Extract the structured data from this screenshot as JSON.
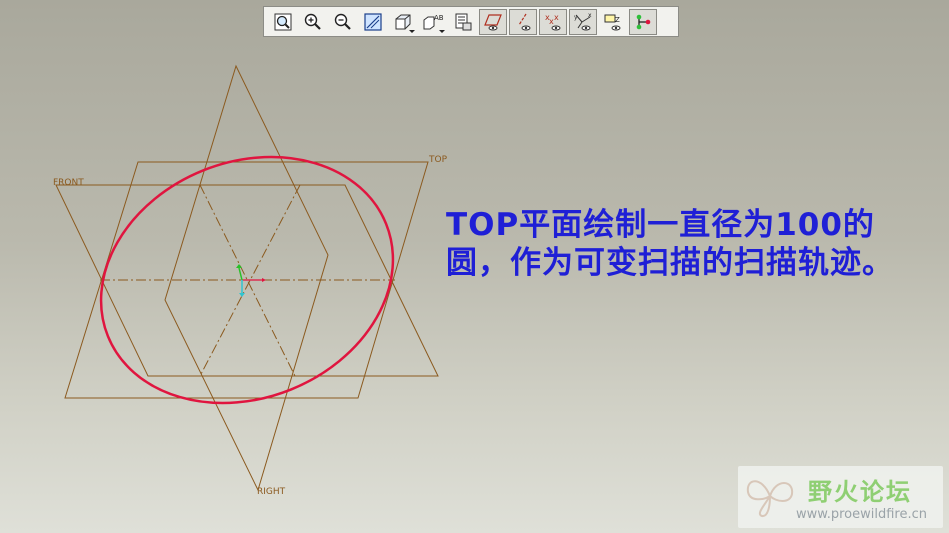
{
  "toolbar": {
    "buttons": [
      {
        "name": "refit-icon",
        "pressed": false,
        "dropdown": false
      },
      {
        "name": "zoom-in-icon",
        "pressed": false,
        "dropdown": false
      },
      {
        "name": "zoom-out-icon",
        "pressed": false,
        "dropdown": false
      },
      {
        "name": "repaint-icon",
        "pressed": false,
        "dropdown": false
      },
      {
        "name": "display-style-icon",
        "pressed": false,
        "dropdown": true
      },
      {
        "name": "saved-views-icon",
        "pressed": false,
        "dropdown": true
      },
      {
        "name": "view-manager-icon",
        "pressed": false,
        "dropdown": false
      },
      {
        "name": "datum-planes-icon",
        "pressed": true,
        "dropdown": false
      },
      {
        "name": "datum-axes-icon",
        "pressed": true,
        "dropdown": false
      },
      {
        "name": "datum-points-icon",
        "pressed": true,
        "dropdown": false
      },
      {
        "name": "coordinate-systems-icon",
        "pressed": true,
        "dropdown": false
      },
      {
        "name": "annotations-icon",
        "pressed": false,
        "dropdown": false
      },
      {
        "name": "spin-center-icon",
        "pressed": true,
        "dropdown": false
      }
    ]
  },
  "viewport": {
    "datum_labels": {
      "front": "FRONT",
      "top": "TOP",
      "right": "RIGHT"
    },
    "colors": {
      "datum": "#8b5a1f",
      "circle": "#e0153f",
      "centerline": "#8b5a1f"
    }
  },
  "annotation": {
    "text": "TOP平面绘制一直径为100的圆，作为可变扫描的扫描轨迹。"
  },
  "watermark": {
    "title": "野火论坛",
    "url": "www.proewildfire.cn"
  }
}
